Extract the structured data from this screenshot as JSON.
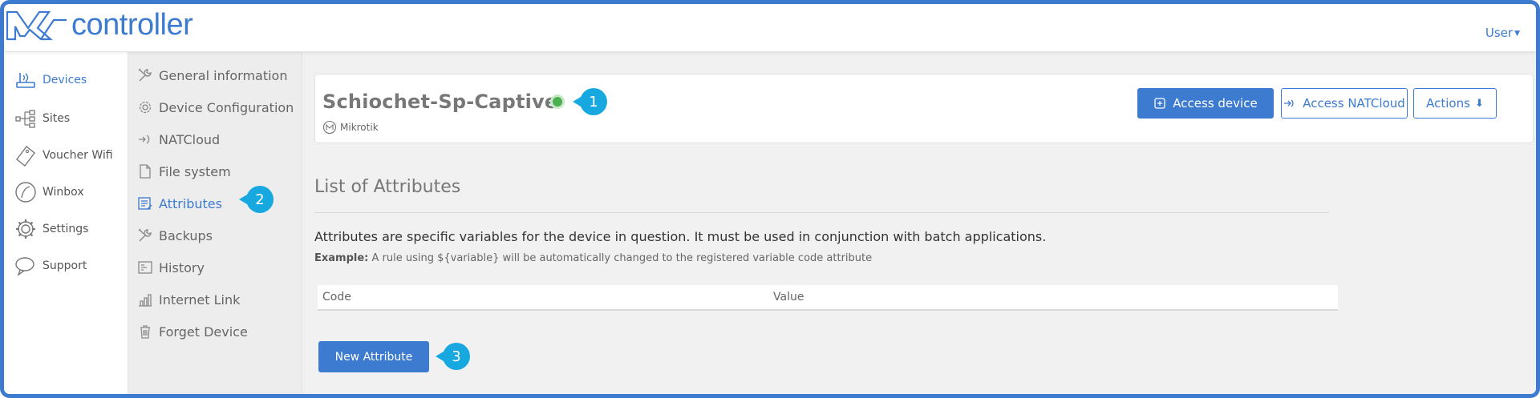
{
  "app": {
    "logo_text": "controller",
    "user_menu": "User"
  },
  "sidebar": {
    "items": [
      {
        "label": "Devices",
        "icon": "router-icon",
        "active": true
      },
      {
        "label": "Sites",
        "icon": "sites-icon",
        "active": false
      },
      {
        "label": "Voucher Wifi",
        "icon": "ticket-icon",
        "active": false
      },
      {
        "label": "Winbox",
        "icon": "winbox-icon",
        "active": false
      },
      {
        "label": "Settings",
        "icon": "gear-icon",
        "active": false
      },
      {
        "label": "Support",
        "icon": "chat-icon",
        "active": false
      }
    ]
  },
  "submenu": {
    "items": [
      {
        "label": "General information",
        "icon": "tools-icon"
      },
      {
        "label": "Device Configuration",
        "icon": "gear-icon"
      },
      {
        "label": "NATCloud",
        "icon": "natcloud-icon"
      },
      {
        "label": "File system",
        "icon": "file-icon"
      },
      {
        "label": "Attributes",
        "icon": "attributes-icon",
        "active": true
      },
      {
        "label": "Backups",
        "icon": "tools-icon"
      },
      {
        "label": "History",
        "icon": "history-icon"
      },
      {
        "label": "Internet Link",
        "icon": "bar-chart-icon"
      },
      {
        "label": "Forget Device",
        "icon": "trash-icon"
      }
    ]
  },
  "device": {
    "name": "Schiochet-Sp-Captive",
    "vendor": "Mikrotik",
    "status_color": "#4caf50"
  },
  "actions": {
    "access_device": "Access device",
    "access_natcloud": "Access NATCloud",
    "actions_menu": "Actions"
  },
  "attributes": {
    "title": "List of Attributes",
    "description": "Attributes are specific variables for the device in question. It must be used in conjunction with batch applications.",
    "example_label": "Example:",
    "example_text": " A rule using ${variable} will be automatically changed to the registered variable code attribute",
    "columns": [
      "Code",
      "Value"
    ],
    "new_button": "New Attribute"
  },
  "callouts": [
    "1",
    "2",
    "3"
  ],
  "colors": {
    "accent": "#3d7bd0",
    "callout": "#17a8e0",
    "status_online": "#4caf50"
  }
}
